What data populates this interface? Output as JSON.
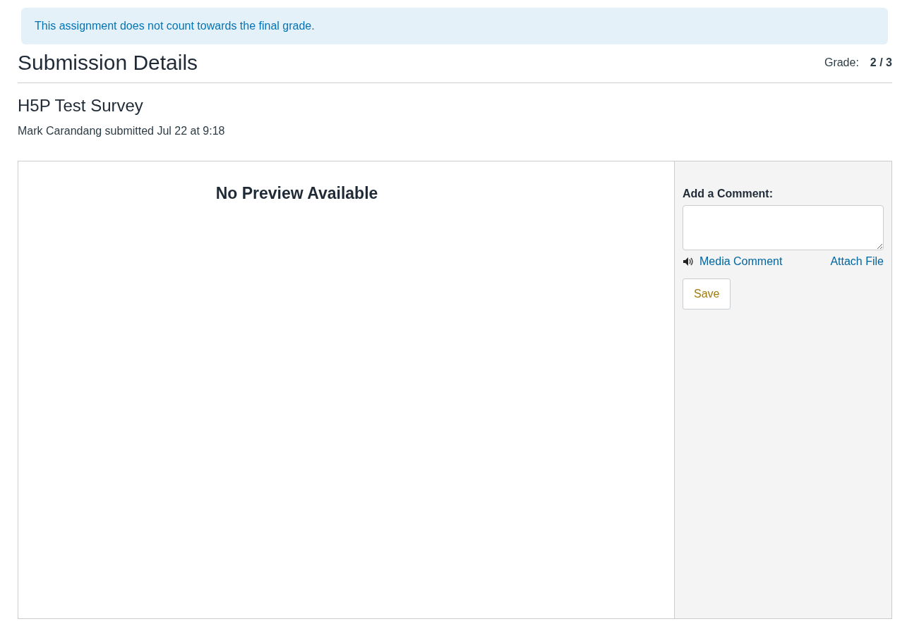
{
  "notice": "This assignment does not count towards the final grade.",
  "heading": "Submission Details",
  "grade": {
    "label": "Grade:",
    "value": "2 / 3"
  },
  "assignment": {
    "title": "H5P Test Survey",
    "submitted_line": "Mark Carandang submitted Jul 22 at 9:18"
  },
  "preview": {
    "message": "No Preview Available"
  },
  "comment_panel": {
    "label": "Add a Comment:",
    "media_link": "Media Comment",
    "attach_link": "Attach File",
    "save_button": "Save"
  }
}
